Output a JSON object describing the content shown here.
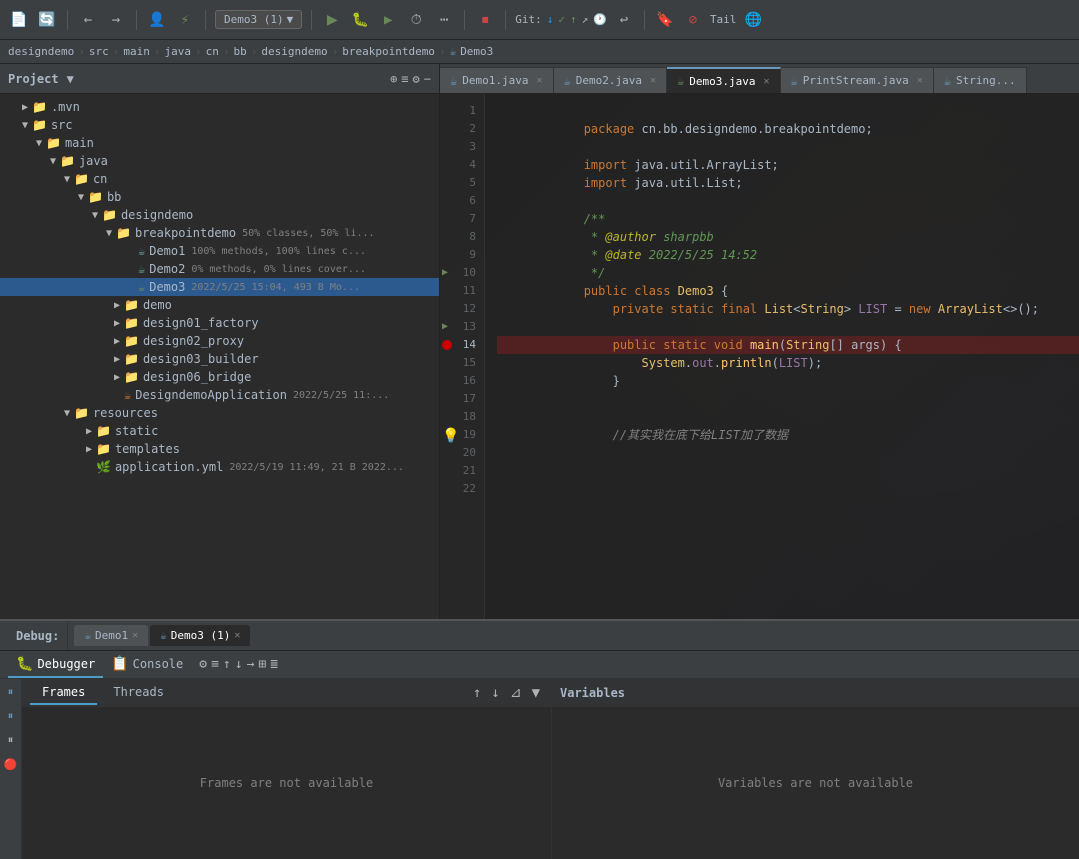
{
  "toolbar": {
    "demo_btn_label": "Demo3 (1)",
    "git_label": "Git:",
    "tail_label": "Tail"
  },
  "breadcrumb": {
    "items": [
      "designdemo",
      "src",
      "main",
      "java",
      "cn",
      "bb",
      "designdemo",
      "breakpointdemo",
      "Demo3"
    ]
  },
  "sidebar": {
    "title": "Project",
    "tree": [
      {
        "id": "mvn",
        "label": ".mvn",
        "indent": 0,
        "type": "folder",
        "expanded": false
      },
      {
        "id": "src",
        "label": "src",
        "indent": 0,
        "type": "folder",
        "expanded": true
      },
      {
        "id": "main",
        "label": "main",
        "indent": 1,
        "type": "folder",
        "expanded": true
      },
      {
        "id": "java",
        "label": "java",
        "indent": 2,
        "type": "folder",
        "expanded": true
      },
      {
        "id": "cn",
        "label": "cn",
        "indent": 3,
        "type": "folder",
        "expanded": true
      },
      {
        "id": "bb",
        "label": "bb",
        "indent": 4,
        "type": "folder",
        "expanded": true
      },
      {
        "id": "designdemo",
        "label": "designdemo",
        "indent": 5,
        "type": "folder",
        "expanded": true
      },
      {
        "id": "breakpointdemo",
        "label": "breakpointdemo",
        "indent": 6,
        "type": "folder",
        "expanded": true,
        "meta": "50% classes, 50% li..."
      },
      {
        "id": "demo1",
        "label": "Demo1",
        "indent": 7,
        "type": "java",
        "meta": "100% methods, 100% lines c..."
      },
      {
        "id": "demo2",
        "label": "Demo2",
        "indent": 7,
        "type": "java",
        "meta": "0% methods, 0% lines cover..."
      },
      {
        "id": "demo3",
        "label": "Demo3",
        "indent": 7,
        "type": "java-active",
        "meta": "2022/5/25 15:04, 493 B Mo...",
        "selected": true
      },
      {
        "id": "demo_folder",
        "label": "demo",
        "indent": 6,
        "type": "folder",
        "expanded": false
      },
      {
        "id": "design01_factory",
        "label": "design01_factory",
        "indent": 6,
        "type": "folder",
        "expanded": false
      },
      {
        "id": "design02_proxy",
        "label": "design02_proxy",
        "indent": 6,
        "type": "folder",
        "expanded": false
      },
      {
        "id": "design03_builder",
        "label": "design03_builder",
        "indent": 6,
        "type": "folder",
        "expanded": false
      },
      {
        "id": "design06_bridge",
        "label": "design06_bridge",
        "indent": 6,
        "type": "folder",
        "expanded": false
      },
      {
        "id": "designdemo_app",
        "label": "DesigndemoApplication",
        "indent": 6,
        "type": "app",
        "meta": "2022/5/25 11:..."
      },
      {
        "id": "resources",
        "label": "resources",
        "indent": 4,
        "type": "folder",
        "expanded": true
      },
      {
        "id": "static",
        "label": "static",
        "indent": 5,
        "type": "folder",
        "expanded": false
      },
      {
        "id": "templates",
        "label": "templates",
        "indent": 5,
        "type": "folder",
        "expanded": false
      },
      {
        "id": "application_yml",
        "label": "application.yml",
        "indent": 5,
        "type": "yml",
        "meta": "2022/5/19 11:49, 21 B 2022..."
      }
    ]
  },
  "editor": {
    "tabs": [
      {
        "label": "Demo1.java",
        "type": "java",
        "active": false
      },
      {
        "label": "Demo2.java",
        "type": "java",
        "active": false
      },
      {
        "label": "Demo3.java",
        "type": "java-active",
        "active": true
      },
      {
        "label": "PrintStream.java",
        "type": "java",
        "active": false
      },
      {
        "label": "String...",
        "type": "java",
        "active": false
      }
    ],
    "lines": [
      {
        "num": 1,
        "content": "package cn.bb.designdemo.breakpointdemo;",
        "tokens": [
          {
            "t": "kw",
            "v": "package"
          },
          {
            "t": "pkg",
            "v": " cn.bb.designdemo.breakpointdemo;"
          }
        ]
      },
      {
        "num": 2,
        "content": ""
      },
      {
        "num": 3,
        "content": "import java.util.ArrayList;",
        "tokens": [
          {
            "t": "kw",
            "v": "import"
          },
          {
            "t": "pkg",
            "v": " java.util.ArrayList;"
          }
        ]
      },
      {
        "num": 4,
        "content": "import java.util.List;",
        "tokens": [
          {
            "t": "kw",
            "v": "import"
          },
          {
            "t": "pkg",
            "v": " java.util.List;"
          }
        ]
      },
      {
        "num": 5,
        "content": ""
      },
      {
        "num": 6,
        "content": "/**",
        "tokens": [
          {
            "t": "javadoc",
            "v": "/**"
          }
        ]
      },
      {
        "num": 7,
        "content": " * @author sharpbb",
        "tokens": [
          {
            "t": "javadoc",
            "v": " * "
          },
          {
            "t": "javadoc-tag",
            "v": "@author"
          },
          {
            "t": "javadoc",
            "v": " sharpbb"
          }
        ]
      },
      {
        "num": 8,
        "content": " * @date 2022/5/25 14:52",
        "tokens": [
          {
            "t": "javadoc",
            "v": " * "
          },
          {
            "t": "javadoc-tag",
            "v": "@date"
          },
          {
            "t": "javadoc",
            "v": " 2022/5/25 14:52"
          }
        ]
      },
      {
        "num": 9,
        "content": " */",
        "tokens": [
          {
            "t": "javadoc",
            "v": " */"
          }
        ]
      },
      {
        "num": 10,
        "content": "public class Demo3 {",
        "tokens": [
          {
            "t": "kw",
            "v": "public"
          },
          {
            "t": "type",
            "v": " "
          },
          {
            "t": "kw",
            "v": "class"
          },
          {
            "t": "type",
            "v": " "
          },
          {
            "t": "cls",
            "v": "Demo3"
          },
          {
            "t": "type",
            "v": " {"
          }
        ]
      },
      {
        "num": 11,
        "content": "    private static final List<String> LIST = new ArrayList<>();",
        "tokens": [
          {
            "t": "type",
            "v": "    "
          },
          {
            "t": "kw",
            "v": "private"
          },
          {
            "t": "type",
            "v": " "
          },
          {
            "t": "kw",
            "v": "static"
          },
          {
            "t": "type",
            "v": " "
          },
          {
            "t": "kw",
            "v": "final"
          },
          {
            "t": "type",
            "v": " "
          },
          {
            "t": "cls",
            "v": "List"
          },
          {
            "t": "type",
            "v": "<"
          },
          {
            "t": "cls",
            "v": "String"
          },
          {
            "t": "type",
            "v": "> "
          },
          {
            "t": "var",
            "v": "LIST"
          },
          {
            "t": "type",
            "v": " = "
          },
          {
            "t": "kw",
            "v": "new"
          },
          {
            "t": "type",
            "v": " "
          },
          {
            "t": "cls",
            "v": "ArrayList"
          },
          {
            "t": "type",
            "v": "<>();"
          }
        ]
      },
      {
        "num": 12,
        "content": ""
      },
      {
        "num": 13,
        "content": "    public static void main(String[] args) {",
        "tokens": [
          {
            "t": "type",
            "v": "    "
          },
          {
            "t": "kw",
            "v": "public"
          },
          {
            "t": "type",
            "v": " "
          },
          {
            "t": "kw",
            "v": "static"
          },
          {
            "t": "type",
            "v": " "
          },
          {
            "t": "kw",
            "v": "void"
          },
          {
            "t": "type",
            "v": " "
          },
          {
            "t": "fn",
            "v": "main"
          },
          {
            "t": "type",
            "v": "("
          },
          {
            "t": "cls",
            "v": "String"
          },
          {
            "t": "type",
            "v": "[] args) {"
          }
        ]
      },
      {
        "num": 14,
        "content": "        System.out.println(LIST);",
        "tokens": [
          {
            "t": "type",
            "v": "        "
          },
          {
            "t": "cls",
            "v": "System"
          },
          {
            "t": "type",
            "v": "."
          },
          {
            "t": "var",
            "v": "out"
          },
          {
            "t": "type",
            "v": "."
          },
          {
            "t": "fn",
            "v": "println"
          },
          {
            "t": "type",
            "v": "("
          },
          {
            "t": "var",
            "v": "LIST"
          },
          {
            "t": "type",
            "v": ");"
          }
        ],
        "highlighted": true
      },
      {
        "num": 15,
        "content": "    }",
        "tokens": [
          {
            "t": "type",
            "v": "    }"
          }
        ]
      },
      {
        "num": 16,
        "content": ""
      },
      {
        "num": 17,
        "content": ""
      },
      {
        "num": 18,
        "content": "    //其实我在底下给LIST加了数据",
        "tokens": [
          {
            "t": "cmt",
            "v": "    //其实我在底下给LIST加了数据"
          }
        ]
      },
      {
        "num": 19,
        "content": ""
      },
      {
        "num": 20,
        "content": ""
      },
      {
        "num": 21,
        "content": ""
      },
      {
        "num": 22,
        "content": ""
      }
    ]
  },
  "debug": {
    "label": "Debug:",
    "session_tabs": [
      {
        "label": "Demo1",
        "active": false
      },
      {
        "label": "Demo3 (1)",
        "active": true
      }
    ],
    "tabs": [
      {
        "label": "Debugger",
        "icon": "🐛",
        "active": true
      },
      {
        "label": "Console",
        "icon": "📋",
        "active": false
      }
    ],
    "subtabs": [
      {
        "label": "Frames",
        "active": true
      },
      {
        "label": "Threads",
        "active": false
      }
    ],
    "frames_empty": "Frames are not available",
    "variables_label": "Variables",
    "variables_empty": "Variables are not available"
  },
  "left_debug_icons": [
    "▶",
    "⏸",
    "⏹",
    "🔴"
  ]
}
